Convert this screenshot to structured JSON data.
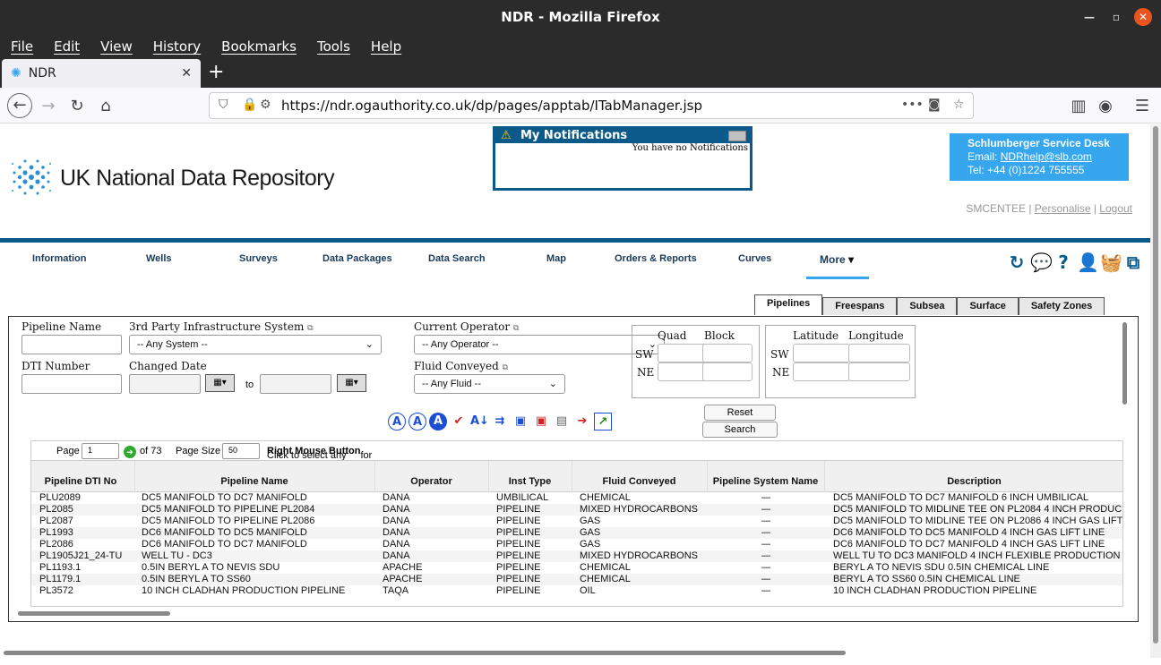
{
  "window": {
    "title": "NDR - Mozilla Firefox"
  },
  "menu": [
    "File",
    "Edit",
    "View",
    "History",
    "Bookmarks",
    "Tools",
    "Help"
  ],
  "tab": {
    "title": "NDR"
  },
  "url": "https://ndr.ogauthority.co.uk/dp/pages/apptab/ITabManager.jsp",
  "logo_text": "UK National Data Repository",
  "notifications": {
    "title": "My Notifications",
    "message": "You have no Notifications"
  },
  "service_desk": {
    "title": "Schlumberger Service Desk",
    "email_label": "Email: ",
    "email": "NDRhelp@slb.com",
    "tel": "Tel: +44 (0)1224 755555"
  },
  "user": {
    "name": "SMCENTEE",
    "personalise": "Personalise",
    "logout": "Logout"
  },
  "nav": [
    "Information",
    "Wells",
    "Surveys",
    "Data Packages",
    "Data Search",
    "Map",
    "Orders & Reports",
    "Curves",
    "More"
  ],
  "subtabs": [
    "Pipelines",
    "Freespans",
    "Subsea",
    "Surface",
    "Safety Zones"
  ],
  "form": {
    "pipeline_name": "Pipeline Name",
    "third_party": "3rd Party Infrastructure System",
    "any_system": "-- Any System --",
    "current_operator": "Current Operator",
    "any_operator": "-- Any Operator --",
    "dti_number": "DTI Number",
    "changed_date": "Changed Date",
    "to": "to",
    "fluid_conveyed": "Fluid Conveyed",
    "any_fluid": "-- Any Fluid --",
    "quad": "Quad",
    "block": "Block",
    "sw": "SW",
    "ne": "NE",
    "latitude": "Latitude",
    "longitude": "Longitude",
    "reset": "Reset",
    "search": "Search"
  },
  "pager": {
    "page_label": "Page",
    "page": "1",
    "of": "of 73",
    "page_size_label": "Page Size",
    "page_size": "50",
    "hint_pre": "Click to select any row(s) in the list below, then click the ",
    "hint_bold": "Right Mouse Button",
    "hint_post": " for more options."
  },
  "table": {
    "columns": [
      "Pipeline DTI No",
      "Pipeline Name",
      "Operator",
      "Inst Type",
      "Fluid Conveyed",
      "Pipeline System Name",
      "Description"
    ],
    "rows": [
      [
        "PLU2089",
        "DC5 MANIFOLD TO DC7 MANIFOLD",
        "DANA",
        "UMBILICAL",
        "CHEMICAL",
        "—",
        "DC5 MANIFOLD TO DC7 MANIFOLD 6 INCH UMBILICAL"
      ],
      [
        "PL2085",
        "DC5 MANIFOLD TO PIPELINE PL2084",
        "DANA",
        "PIPELINE",
        "MIXED HYDROCARBONS",
        "—",
        "DC5 MANIFOLD TO MIDLINE TEE ON PL2084 4 INCH PRODUC"
      ],
      [
        "PL2087",
        "DC5 MANIFOLD TO PIPELINE PL2086",
        "DANA",
        "PIPELINE",
        "GAS",
        "—",
        "DC5 MANIFOLD TO MIDLINE TEE ON PL2086 4 INCH GAS LIFT"
      ],
      [
        "PL1993",
        "DC6 MANIFOLD TO DC5 MANIFOLD",
        "DANA",
        "PIPELINE",
        "GAS",
        "—",
        "DC6 MANIFOLD TO DC5 MANIFOLD 4 INCH GAS LIFT LINE"
      ],
      [
        "PL2086",
        "DC6 MANIFOLD TO DC7 MANIFOLD",
        "DANA",
        "PIPELINE",
        "GAS",
        "—",
        "DC6 MANIFOLD TO DC7 MANIFOLD 4 INCH GAS LIFT LINE"
      ],
      [
        "PL1905J21_24-TU",
        "WELL TU - DC3",
        "DANA",
        "PIPELINE",
        "MIXED HYDROCARBONS",
        "—",
        "WELL TU TO DC3 MANIFOLD 4 INCH FLEXIBLE PRODUCTION"
      ],
      [
        "PL1193.1",
        "0.5IN BERYL A TO NEVIS SDU",
        "APACHE",
        "PIPELINE",
        "CHEMICAL",
        "—",
        "BERYL A TO NEVIS SDU 0.5IN CHEMICAL LINE"
      ],
      [
        "PL1179.1",
        "0.5IN BERYL A TO SS60",
        "APACHE",
        "PIPELINE",
        "CHEMICAL",
        "—",
        "BERYL A TO SS60 0.5IN CHEMICAL LINE"
      ],
      [
        "PL3572",
        "10 INCH CLADHAN PRODUCTION PIPELINE",
        "TAQA",
        "PIPELINE",
        "OIL",
        "—",
        "10 INCH CLADHAN PRODUCTION PIPELINE"
      ]
    ]
  }
}
